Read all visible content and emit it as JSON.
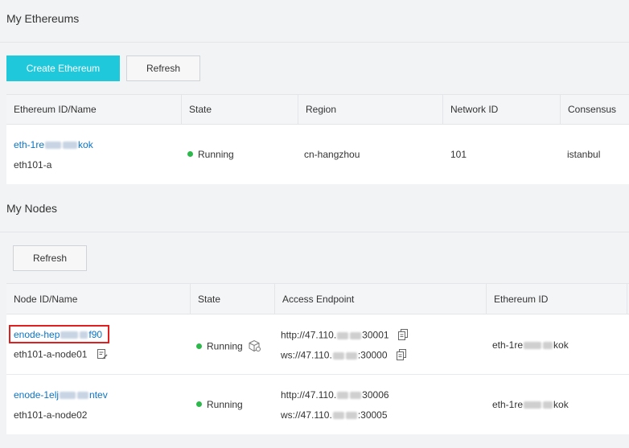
{
  "ethereums_section": {
    "title": "My Ethereums",
    "create_button": "Create Ethereum",
    "refresh_button": "Refresh",
    "columns": [
      "Ethereum ID/Name",
      "State",
      "Region",
      "Network ID",
      "Consensus"
    ],
    "rows": [
      {
        "id_prefix": "eth-1re",
        "id_suffix": "kok",
        "name": "eth101-a",
        "state": "Running",
        "region": "cn-hangzhou",
        "network_id": "101",
        "consensus": "istanbul"
      }
    ]
  },
  "nodes_section": {
    "title": "My Nodes",
    "refresh_button": "Refresh",
    "columns": [
      "Node ID/Name",
      "State",
      "Access Endpoint",
      "Ethereum ID"
    ],
    "rows": [
      {
        "id_prefix": "enode-hep",
        "id_suffix": "f90",
        "name": "eth101-a-node01",
        "state": "Running",
        "http_prefix": "http://47.110.",
        "http_suffix": "30001",
        "ws_prefix": "ws://47.110.",
        "ws_suffix": ":30000",
        "eth_prefix": "eth-1re",
        "eth_suffix": "kok",
        "highlighted": true
      },
      {
        "id_prefix": "enode-1elj",
        "id_suffix": "ntev",
        "name": "eth101-a-node02",
        "state": "Running",
        "http_prefix": "http://47.110.",
        "http_suffix": "30006",
        "ws_prefix": "ws://47.110.",
        "ws_suffix": ":30005",
        "eth_prefix": "eth-1re",
        "eth_suffix": "kok",
        "highlighted": false
      }
    ]
  },
  "colors": {
    "primary": "#1fc8db",
    "link": "#0b74c5",
    "running": "#2cb84a",
    "highlight": "#e02020"
  }
}
